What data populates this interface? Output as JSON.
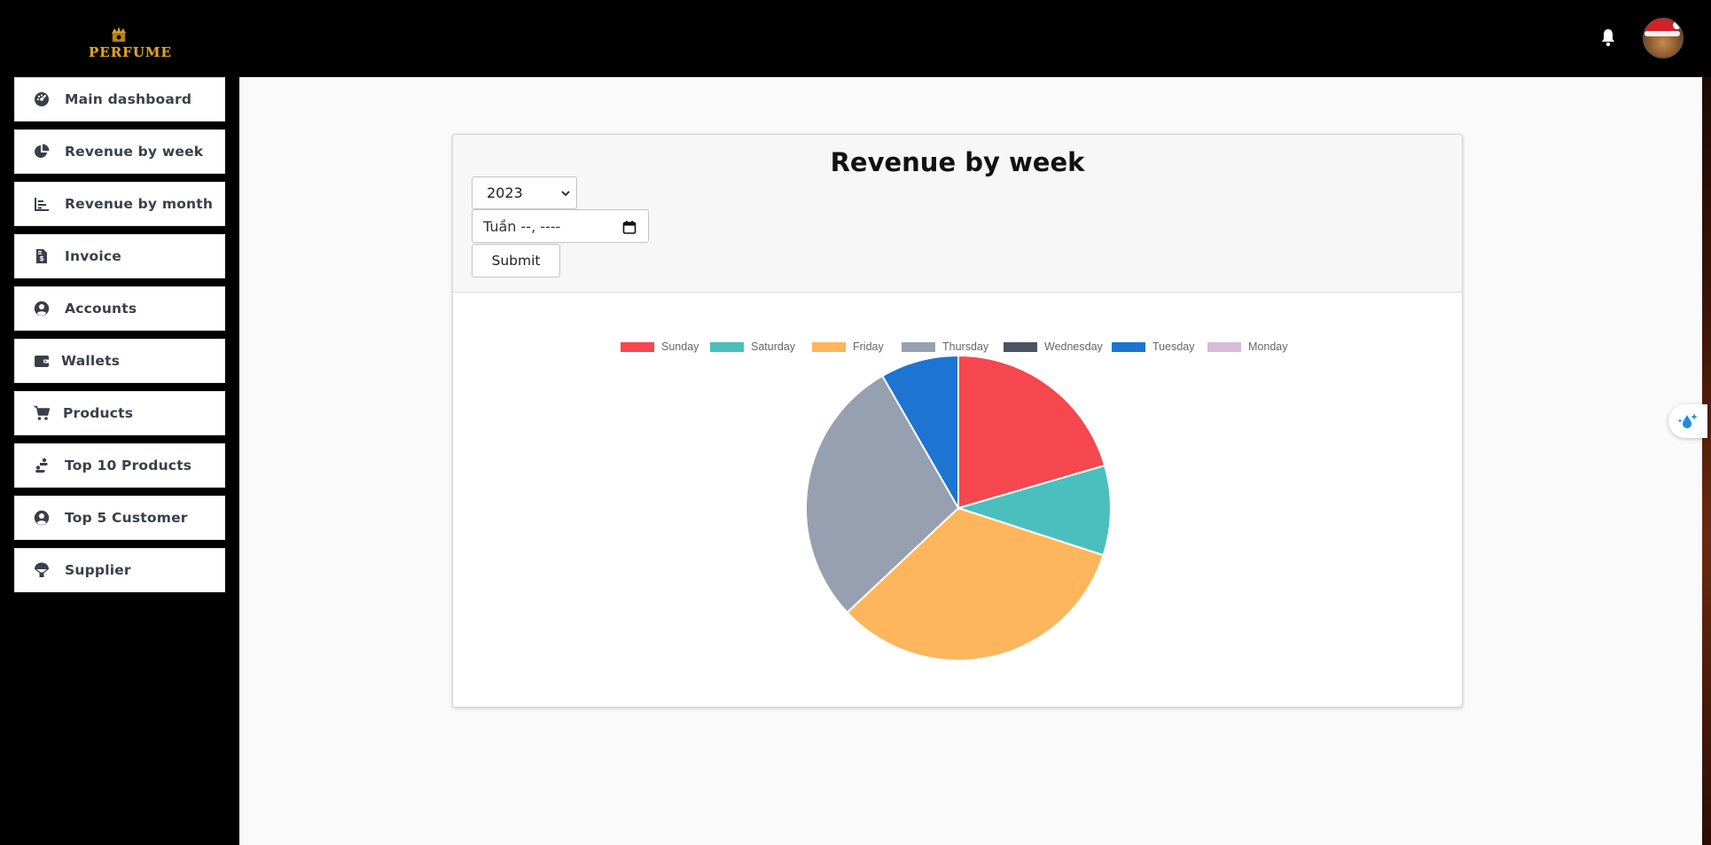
{
  "brand": {
    "logo_text": "PERFUME",
    "logo_color": "#d9a520"
  },
  "topbar": {
    "notifications_icon": "bell-icon",
    "avatar_icon": "avatar-santa-cat"
  },
  "sidebar": {
    "items": [
      {
        "label": "Main dashboard",
        "icon": "gauge-icon"
      },
      {
        "label": "Revenue by week",
        "icon": "pie-chart-icon"
      },
      {
        "label": "Revenue by month",
        "icon": "bar-chart-icon"
      },
      {
        "label": "Invoice",
        "icon": "invoice-dollar-icon"
      },
      {
        "label": "Accounts",
        "icon": "user-circle-icon"
      },
      {
        "label": "Wallets",
        "icon": "wallet-icon"
      },
      {
        "label": "Products",
        "icon": "cart-icon"
      },
      {
        "label": "Top 10 Products",
        "icon": "people-carry-icon"
      },
      {
        "label": "Top 5 Customer",
        "icon": "user-circle-icon"
      },
      {
        "label": "Supplier",
        "icon": "parachute-box-icon"
      }
    ]
  },
  "panel": {
    "title": "Revenue by week",
    "year_select": {
      "selected": "2023"
    },
    "week_input": {
      "placeholder": "Tuần --, ----"
    },
    "submit_label": "Submit"
  },
  "colors": {
    "sunday": "#f5474d",
    "saturday": "#4bbfbd",
    "friday": "#ffb55c",
    "thursday": "#97a0b0",
    "wednesday": "#4b5360",
    "tuesday": "#1d74d1",
    "monday": "#d8bcd8"
  },
  "chart_data": {
    "type": "pie",
    "categories": [
      "Sunday",
      "Saturday",
      "Friday",
      "Thursday",
      "Wednesday",
      "Tuesday",
      "Monday"
    ],
    "values": [
      20.5,
      9.5,
      33,
      28.7,
      0,
      8.3,
      0
    ],
    "colors": [
      "#f5474d",
      "#4bbfbd",
      "#ffb55c",
      "#97a0b0",
      "#4b5360",
      "#1d74d1",
      "#d8bcd8"
    ],
    "legend": "top"
  }
}
